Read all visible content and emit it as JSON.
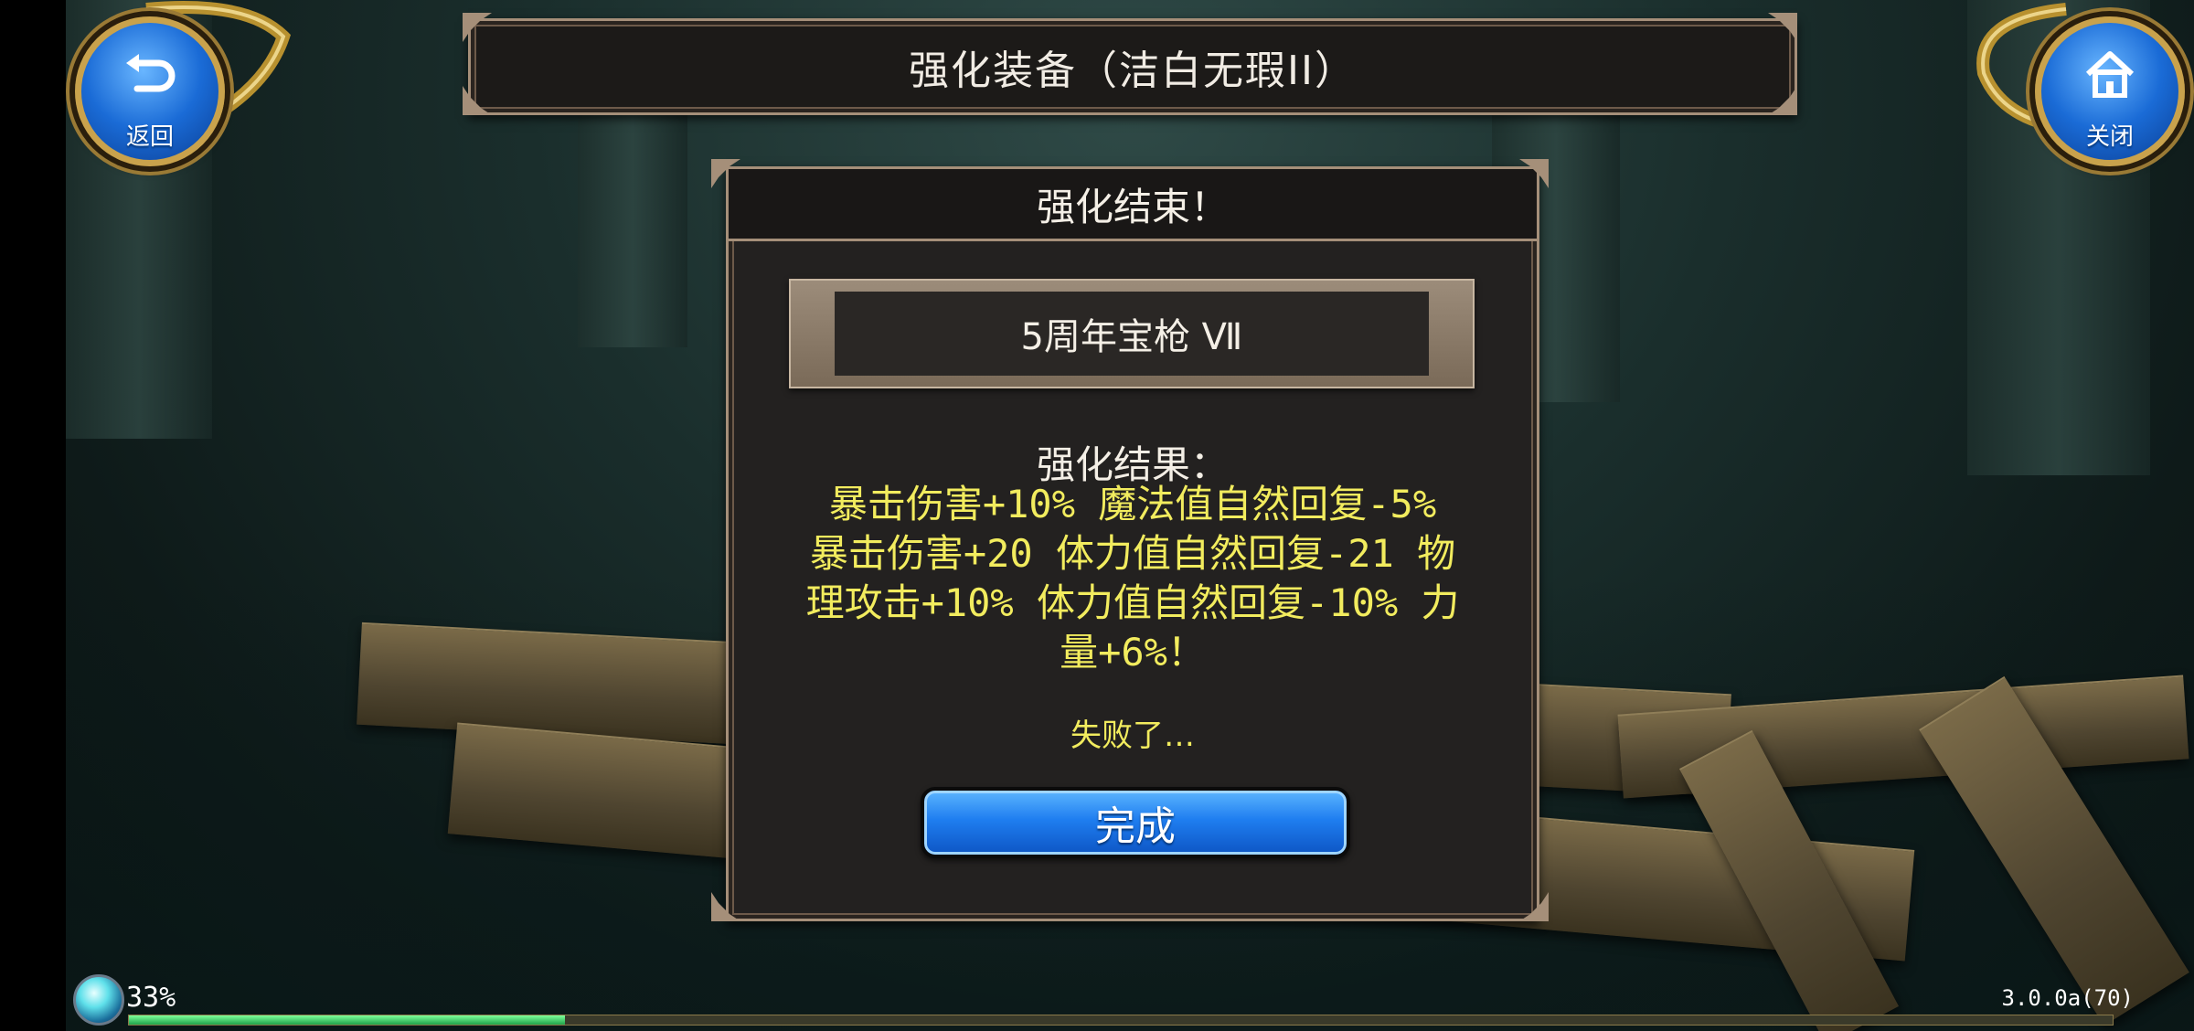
{
  "header": {
    "title": "强化装备（洁白无瑕II）"
  },
  "nav": {
    "back_label": "返回",
    "close_label": "关闭"
  },
  "dialog": {
    "title": "强化结束！",
    "item_name": "5周年宝枪 Ⅶ",
    "result_label": "强化结果：",
    "result_lines": [
      "暴击伤害+10% 魔法值自然回复-5%",
      "暴击伤害+20 体力值自然回复-21 物",
      "理攻击+10% 体力值自然回复-10% 力",
      "量+6%！"
    ],
    "status": "失败了…",
    "done_label": "完成"
  },
  "footer": {
    "progress_text": "33%",
    "progress_value": 0.22,
    "version": "3.0.0a(70)"
  },
  "colors": {
    "result_text": "#f2ec5e",
    "button_blue": "#1f7ef0",
    "frame_border": "#a58f79"
  },
  "icons": {
    "back": "return-arrow-icon",
    "close": "home-icon"
  }
}
